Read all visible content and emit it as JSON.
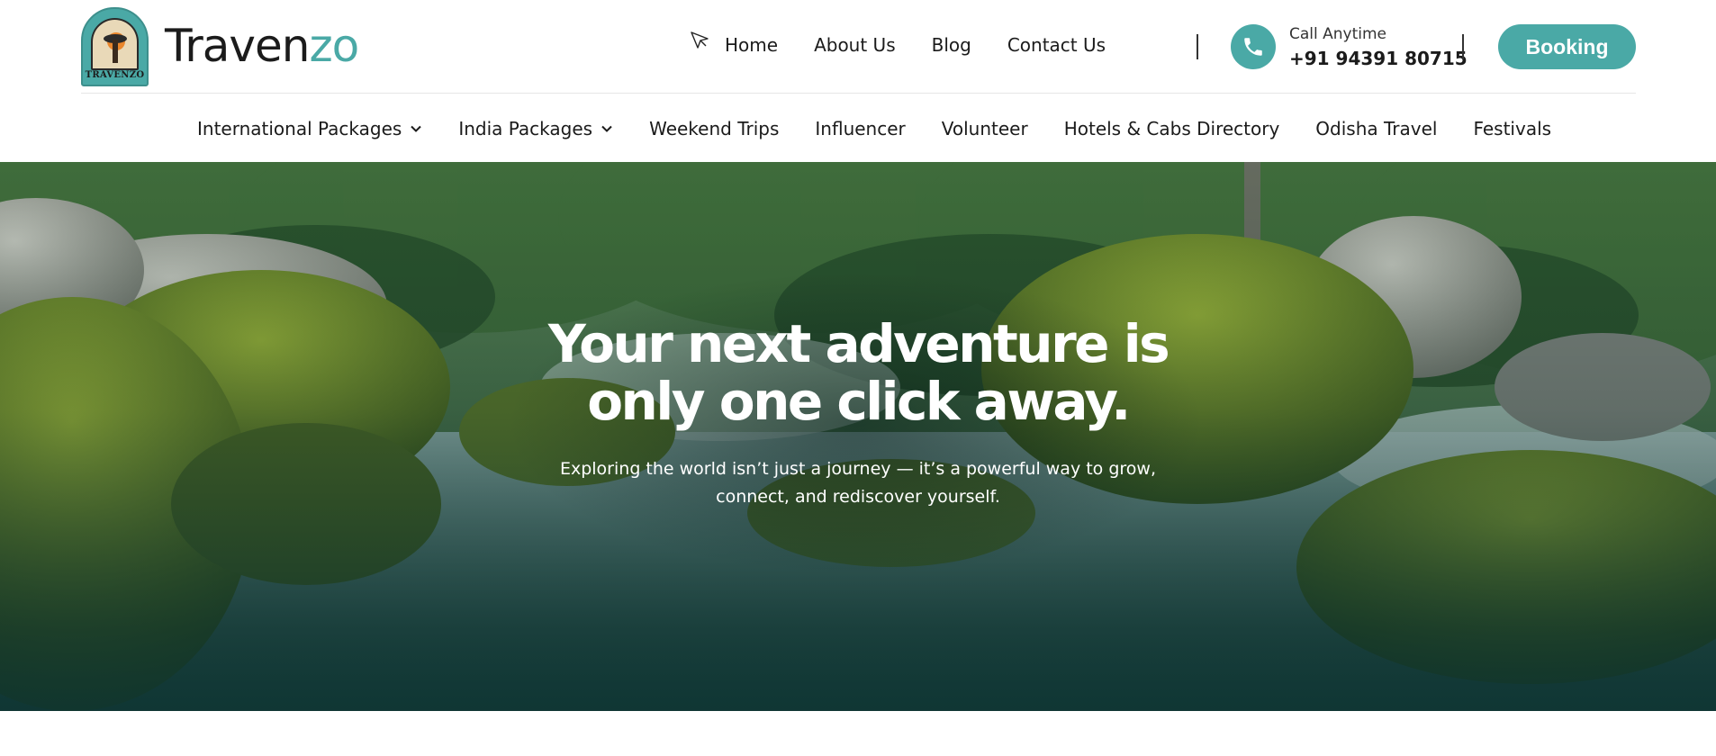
{
  "brand": {
    "logo_text": "TRAVENZO",
    "name_main": "Traven",
    "name_accent": "zo"
  },
  "top_nav": [
    "Home",
    "About Us",
    "Blog",
    "Contact Us"
  ],
  "contact": {
    "label": "Call Anytime",
    "phone": "+91 94391 80715"
  },
  "booking_label": "Booking",
  "main_nav": [
    {
      "label": "International Packages",
      "dropdown": true
    },
    {
      "label": "India Packages",
      "dropdown": true
    },
    {
      "label": "Weekend Trips",
      "dropdown": false
    },
    {
      "label": "Influencer",
      "dropdown": false
    },
    {
      "label": "Volunteer",
      "dropdown": false
    },
    {
      "label": "Hotels & Cabs Directory",
      "dropdown": false
    },
    {
      "label": "Odisha Travel",
      "dropdown": false
    },
    {
      "label": "Festivals",
      "dropdown": false
    }
  ],
  "hero": {
    "title_line1": "Your next adventure is",
    "title_line2": "only one click away.",
    "subtitle_line1": "Exploring the world isn’t just a journey — it’s a powerful way to grow,",
    "subtitle_line2": "connect, and rediscover yourself."
  },
  "colors": {
    "accent": "#4aa9a6",
    "text": "#1b1b1b"
  },
  "icons": {
    "phone": "phone-icon",
    "chevron": "chevron-down-icon",
    "cursor": "cursor-icon"
  }
}
